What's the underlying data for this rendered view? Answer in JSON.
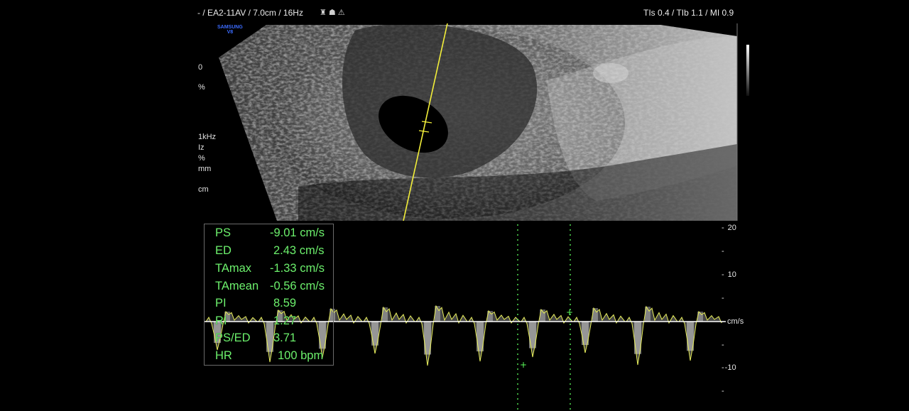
{
  "header": {
    "probe_info": "- / EA2-11AV / 7.0cm / 16Hz",
    "icons": [
      "har-icon",
      "baby-icon",
      "warning-icon"
    ],
    "safety": "TIs  0.4 / TIb  1.1 / MI  0.9"
  },
  "brand": {
    "line1": "SAMSUNG",
    "line2": "V8"
  },
  "side_params": [
    "0",
    "%",
    "1kHz",
    "Iz",
    "%",
    "mm",
    "cm"
  ],
  "measurements": [
    {
      "label": "PS",
      "value": "-9.01 cm/s"
    },
    {
      "label": "ED",
      "value": "2.43 cm/s"
    },
    {
      "label": "TAmax",
      "value": "-1.33 cm/s"
    },
    {
      "label": "TAmean",
      "value": "-0.56 cm/s"
    },
    {
      "label": "PI",
      "value": "8.59"
    },
    {
      "label": "RI",
      "value": "1.27"
    },
    {
      "label": "PS/ED",
      "value": "3.71"
    },
    {
      "label": "HR",
      "value": "100 bpm"
    }
  ],
  "velocity_scale": {
    "ticks": [
      "20",
      "10",
      "-10"
    ],
    "unit": "cm/s"
  },
  "colors": {
    "measurement_text": "#6cf06c",
    "trace": "#e8ef5a",
    "cursor_line": "#f3ef3a",
    "caliper_lines": "#5cff5c"
  }
}
